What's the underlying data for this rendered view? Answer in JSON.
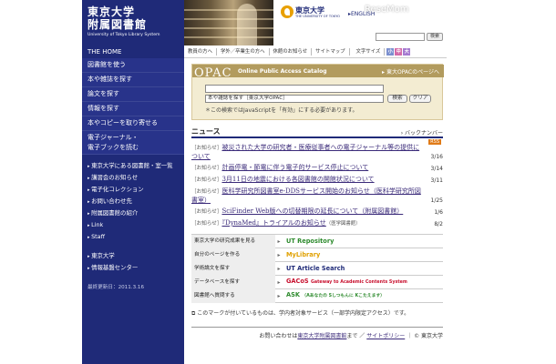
{
  "header": {
    "logo_ja_line1": "東京大学",
    "logo_ja_line2": "附属図書館",
    "logo_en": "University of Tokyo Library System",
    "ut_name": "東京大学",
    "ut_en": "THE UNIVERSITY OF TOKYO",
    "english_link": "▸ENGLISH",
    "watermark": "ReseMom",
    "search_button": "検索"
  },
  "topnav": {
    "home": "THE HOME",
    "links": [
      "教員の方へ",
      "学外／卒業生の方へ",
      "休館のお知らせ",
      "サイトマップ"
    ],
    "font_size_label": "文字サイズ",
    "font_sizes": [
      "小",
      "中",
      "大"
    ],
    "font_size_colors": [
      "#7b8fcf",
      "#d46aa8",
      "#a57ad0"
    ]
  },
  "sidebar": {
    "main_items": [
      "図書館を使う",
      "本や雑誌を探す",
      "論文を探す",
      "情報を探す",
      "本やコピーを取り寄せる"
    ],
    "ejournal_line1": "電子ジャーナル・",
    "ejournal_line2": "電子ブックを読む",
    "sub_items_1": [
      "東京大学にある図書館・室一覧",
      "講習会のお知らせ",
      "電子化コレクション",
      "お問い合わせ先",
      "附属図書館の紹介",
      "Link",
      "Staff"
    ],
    "sub_items_2": [
      "東京大学",
      "情報基盤センター"
    ],
    "updated": "最終更新日：2011.3.16"
  },
  "opac": {
    "logo": "OPAC",
    "title": "Online Public Access Catalog",
    "link": "▸ 東大OPACのページへ",
    "select_value": "本や雑誌を探す［東京大学OPAC］",
    "search_button": "検索",
    "clear_button": "クリア",
    "note": "＊この検索ではJavaScriptを「有効」にする必要があります。"
  },
  "news": {
    "title": "ニュース",
    "backnumber": "› バックナンバー",
    "rss": "RSS",
    "items": [
      {
        "cat": "［お知らせ］",
        "text": "被災された大学の研究者・医療従事者への電子ジャーナル等の提供について",
        "note": "",
        "date": "3/16"
      },
      {
        "cat": "［お知らせ］",
        "text": "計画停電・節電に伴う電子的サービス停止について",
        "note": "",
        "date": "3/14"
      },
      {
        "cat": "［お知らせ］",
        "text": "3月11日の地震における各図書館の開館状況について",
        "note": "",
        "date": "3/11"
      },
      {
        "cat": "［お知らせ］",
        "text": "医科学研究所図書室e-DDSサービス開始のお知らせ（医科学研究所図書室）",
        "note": "",
        "date": "1/25"
      },
      {
        "cat": "［お知らせ］",
        "text": "SciFinder Web版への切替期限の延長について（附属図書館）",
        "note": "",
        "date": "1/6"
      },
      {
        "cat": "［お知らせ］",
        "text": "『DynaMed』トライアルのお知らせ",
        "note": "（医学図書館）",
        "date": "8/2"
      }
    ]
  },
  "services": [
    {
      "label": "東京大学の研究成果を見る",
      "name": "UT Repository",
      "sub": "",
      "color": "#2e8b2e"
    },
    {
      "label": "自分のページを作る",
      "name": "MyLibrary",
      "sub": "",
      "color": "#e0a000"
    },
    {
      "label": "学術論文を探す",
      "name": "UT Article Search",
      "sub": "",
      "color": "#1f2a78"
    },
    {
      "label": "データベースを探す",
      "name": "GACoS",
      "sub": "Gateway to Academic Contents System",
      "color": "#c8102e"
    },
    {
      "label": "図書館へ質問する",
      "name": "ASK",
      "sub": "（Aあなたの Sしつもんに Kこたえます）",
      "color": "#2e8b2e"
    }
  ],
  "footnote": "このマークが付いているものは、学内者対象サービス（一部学内限定アクセス）です。",
  "footer": {
    "prefix": "お問い合わせは",
    "contact": "東京大学附属図書館",
    "mid": "まで ／",
    "policy": "サイトポリシー",
    "copyright": "｜ © 東京大学"
  }
}
